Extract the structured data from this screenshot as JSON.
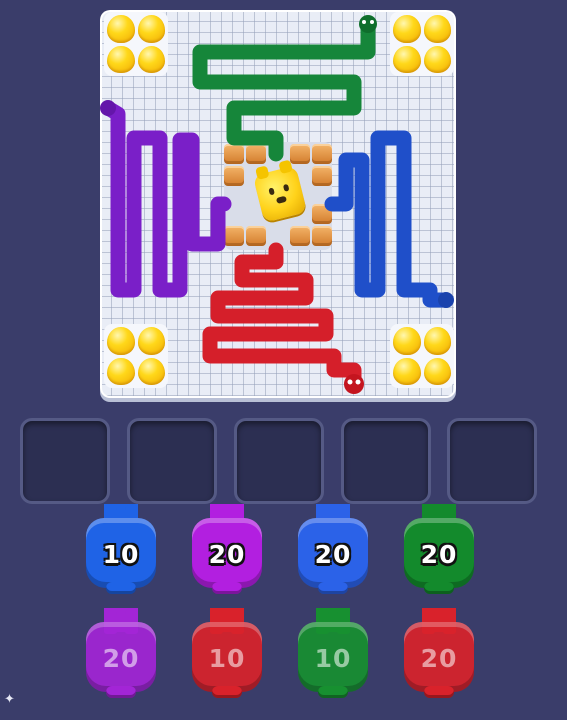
{
  "board": {
    "egg_color": "#ffd21a",
    "snakes": [
      {
        "color": "green",
        "hex": "#16863a"
      },
      {
        "color": "purple",
        "hex": "#7a1fc8"
      },
      {
        "color": "blue",
        "hex": "#1f4fc9"
      },
      {
        "color": "red",
        "hex": "#d51f2a"
      }
    ],
    "center_character": "yellow-dog"
  },
  "slots": {
    "count": 5,
    "empty": true
  },
  "bunnies": {
    "front_row": [
      {
        "number": "10",
        "color": "#1f63e6"
      },
      {
        "number": "20",
        "color": "#b21fe0"
      },
      {
        "number": "20",
        "color": "#2b62e8"
      },
      {
        "number": "20",
        "color": "#138a2c"
      }
    ],
    "back_row": [
      {
        "number": "20",
        "color": "#a325d6"
      },
      {
        "number": "10",
        "color": "#d9222b"
      },
      {
        "number": "10",
        "color": "#179030"
      },
      {
        "number": "20",
        "color": "#d9222b"
      }
    ]
  }
}
